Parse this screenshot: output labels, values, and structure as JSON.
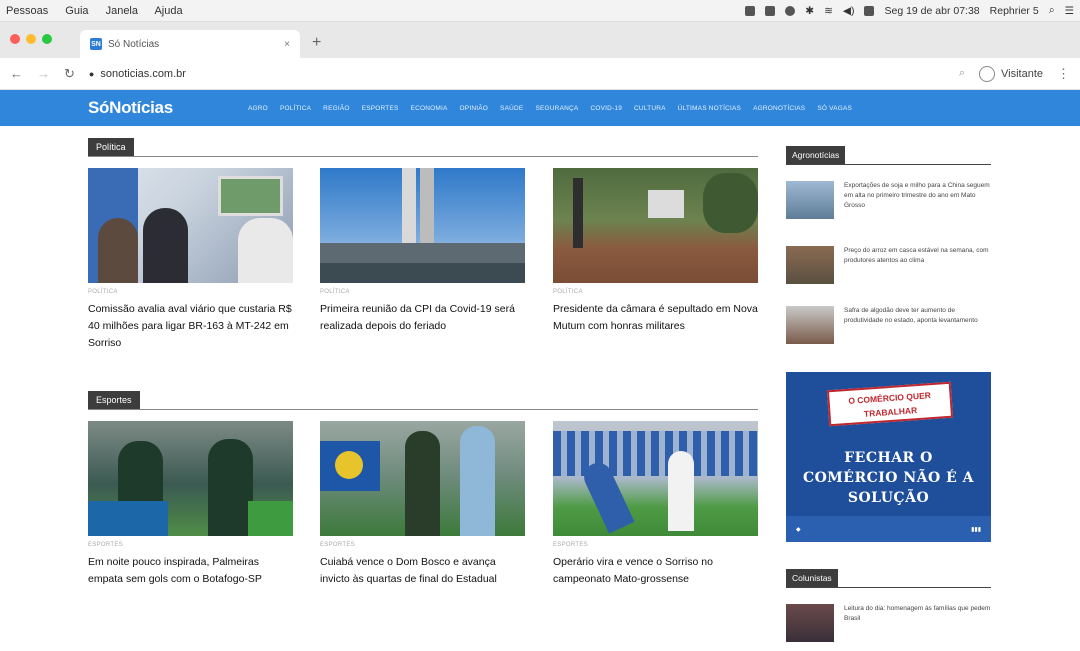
{
  "menubar": {
    "items": [
      "Pessoas",
      "Guia",
      "Janela",
      "Ajuda"
    ],
    "datetime": "Seg 19 de abr 07:38",
    "user": "Rephrier 5"
  },
  "tab": {
    "favicon": "SN",
    "title": "Só Notícias"
  },
  "address": {
    "url": "sonoticias.com.br",
    "profile": "Visitante"
  },
  "site": {
    "logo": "SóNotícias",
    "nav": [
      "Agro",
      "Política",
      "Região",
      "Esportes",
      "Economia",
      "Opinião",
      "Saúde",
      "Segurança",
      "Covid-19",
      "Cultura",
      "Últimas notícias",
      "Agronotícias",
      "Só Vagas"
    ]
  },
  "sections": {
    "politica": "Política",
    "esportes": "Esportes"
  },
  "cards_politica": [
    {
      "category": "Política",
      "title": "Comissão avalia aval viário que custaria R$ 40 milhões para ligar BR-163 à MT-242 em Sorriso"
    },
    {
      "category": "Política",
      "title": "Primeira reunião da CPI da Covid-19 será realizada depois do feriado"
    },
    {
      "category": "Política",
      "title": "Presidente da câmara é sepultado em Nova Mutum com honras militares"
    }
  ],
  "cards_esportes": [
    {
      "category": "Esportes",
      "title": "Em noite pouco inspirada, Palmeiras empata sem gols com o Botafogo-SP"
    },
    {
      "category": "Esportes",
      "title": "Cuiabá vence o Dom Bosco e avança invicto às quartas de final do Estadual"
    },
    {
      "category": "Esportes",
      "title": "Operário vira e vence o Sorriso no campeonato Mato-grossense"
    }
  ],
  "sidebar": {
    "agro_title": "Agronotícias",
    "agro_items": [
      "Exportações de soja e milho para a China seguem em alta no primeiro trimestre do ano em Mato Grosso",
      "Preço do arroz em casca estável na semana, com produtores atentos ao clima",
      "Safra de algodão deve ter aumento de produtividade no estado, aponta levantamento"
    ],
    "ad_banner": "O COMÉRCIO QUER TRABALHAR",
    "ad_main": "FECHAR O COMÉRCIO NÃO É A SOLUÇÃO",
    "colunistas_title": "Colunistas",
    "colunistas_items": [
      "Leitura do dia: homenagem às famílias que pedem Brasil"
    ]
  },
  "colors": {
    "nav": "#2f86db",
    "section": "#3d3d3d",
    "ad": "#1f4f9a"
  }
}
